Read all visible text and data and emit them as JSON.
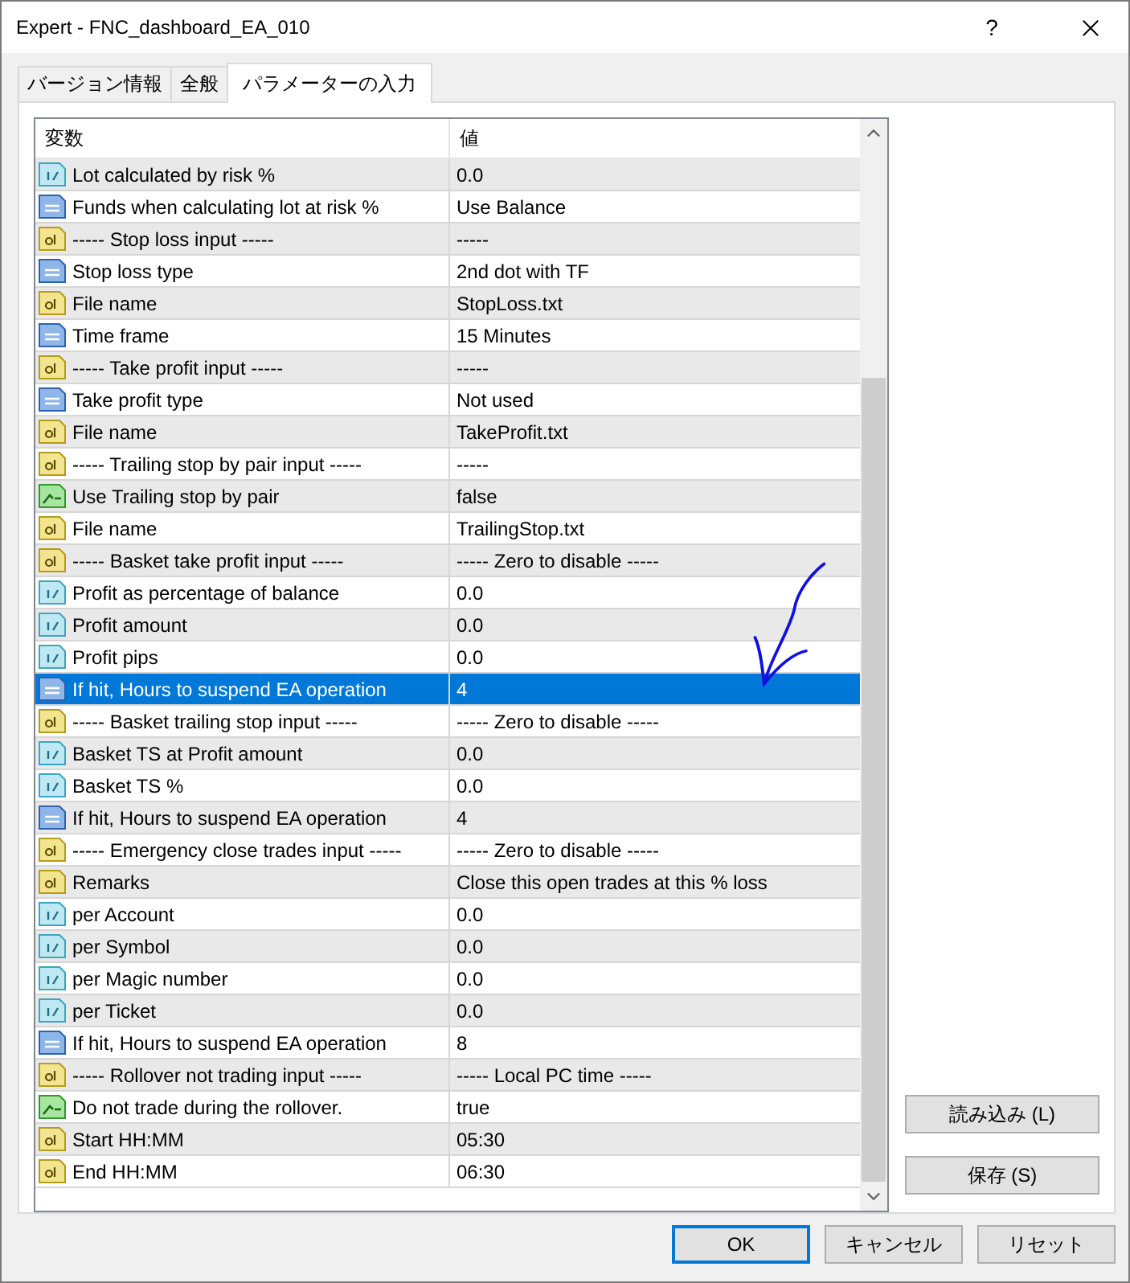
{
  "window": {
    "title": "Expert - FNC_dashboard_EA_010",
    "help": "?"
  },
  "tabs": [
    {
      "label": "バージョン情報",
      "selected": false
    },
    {
      "label": "全般",
      "selected": false
    },
    {
      "label": "パラメーターの入力",
      "selected": true
    }
  ],
  "table": {
    "columns": [
      "変数",
      "値"
    ],
    "rows": [
      {
        "kind": "real",
        "name": "Lot calculated by risk %",
        "value": "0.0",
        "selected": false
      },
      {
        "kind": "int",
        "name": "Funds when calculating lot at risk %",
        "value": "Use Balance",
        "selected": false
      },
      {
        "kind": "string",
        "name": "----- Stop loss input -----",
        "value": "-----",
        "selected": false
      },
      {
        "kind": "int",
        "name": "Stop loss type",
        "value": "2nd dot with TF",
        "selected": false
      },
      {
        "kind": "string",
        "name": "File name",
        "value": "StopLoss.txt",
        "selected": false
      },
      {
        "kind": "int",
        "name": "Time frame",
        "value": "15 Minutes",
        "selected": false
      },
      {
        "kind": "string",
        "name": "----- Take profit input -----",
        "value": "-----",
        "selected": false
      },
      {
        "kind": "int",
        "name": "Take profit type",
        "value": "Not used",
        "selected": false
      },
      {
        "kind": "string",
        "name": "File name",
        "value": "TakeProfit.txt",
        "selected": false
      },
      {
        "kind": "string",
        "name": "----- Trailing stop by pair input -----",
        "value": "-----",
        "selected": false
      },
      {
        "kind": "bool",
        "name": "Use Trailing stop by pair",
        "value": "false",
        "selected": false
      },
      {
        "kind": "string",
        "name": "File name",
        "value": "TrailingStop.txt",
        "selected": false
      },
      {
        "kind": "string",
        "name": "----- Basket take profit input -----",
        "value": "----- Zero to disable -----",
        "selected": false
      },
      {
        "kind": "real",
        "name": "Profit as percentage of balance",
        "value": "0.0",
        "selected": false
      },
      {
        "kind": "real",
        "name": "Profit amount",
        "value": "0.0",
        "selected": false
      },
      {
        "kind": "real",
        "name": "Profit pips",
        "value": "0.0",
        "selected": false
      },
      {
        "kind": "int",
        "name": "If hit, Hours to suspend EA operation",
        "value": "4",
        "selected": true
      },
      {
        "kind": "string",
        "name": "----- Basket trailing stop input -----",
        "value": "----- Zero to disable -----",
        "selected": false
      },
      {
        "kind": "real",
        "name": "Basket TS at Profit amount",
        "value": "0.0",
        "selected": false
      },
      {
        "kind": "real",
        "name": "Basket TS %",
        "value": "0.0",
        "selected": false
      },
      {
        "kind": "int",
        "name": "If hit, Hours to suspend EA operation",
        "value": "4",
        "selected": false
      },
      {
        "kind": "string",
        "name": "----- Emergency close trades input -----",
        "value": "----- Zero to disable -----",
        "selected": false
      },
      {
        "kind": "string",
        "name": "Remarks",
        "value": "Close this open trades at this % loss",
        "selected": false
      },
      {
        "kind": "real",
        "name": "per Account",
        "value": "0.0",
        "selected": false
      },
      {
        "kind": "real",
        "name": "per Symbol",
        "value": "0.0",
        "selected": false
      },
      {
        "kind": "real",
        "name": "per Magic number",
        "value": "0.0",
        "selected": false
      },
      {
        "kind": "real",
        "name": "per Ticket",
        "value": "0.0",
        "selected": false
      },
      {
        "kind": "int",
        "name": "If hit, Hours to suspend EA operation",
        "value": "8",
        "selected": false
      },
      {
        "kind": "string",
        "name": "----- Rollover not trading input -----",
        "value": "----- Local PC time -----",
        "selected": false
      },
      {
        "kind": "bool",
        "name": "Do not trade during the rollover.",
        "value": "true",
        "selected": false
      },
      {
        "kind": "string",
        "name": "Start HH:MM",
        "value": "05:30",
        "selected": false
      },
      {
        "kind": "string",
        "name": "End HH:MM",
        "value": "06:30",
        "selected": false
      }
    ]
  },
  "side_buttons": [
    "読み込み (L)",
    "保存 (S)"
  ],
  "buttons": [
    "OK",
    "キャンセル",
    "リセット"
  ]
}
